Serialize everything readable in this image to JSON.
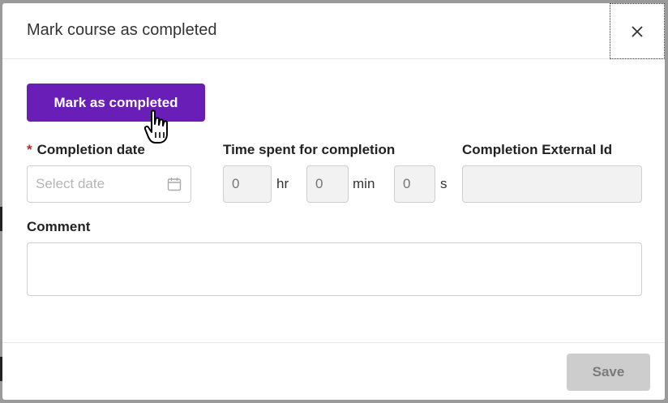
{
  "modal": {
    "title": "Mark course as completed",
    "close_icon": "close-icon"
  },
  "actions": {
    "mark_completed_label": "Mark as completed"
  },
  "fields": {
    "completion_date": {
      "required_mark": "*",
      "label": "Completion date",
      "placeholder": "Select date",
      "icon": "calendar-icon"
    },
    "time_spent": {
      "label": "Time spent for completion",
      "hours_placeholder": "0",
      "hours_unit": "hr",
      "minutes_placeholder": "0",
      "minutes_unit": "min",
      "seconds_placeholder": "0",
      "seconds_unit": "s"
    },
    "external_id": {
      "label": "Completion External Id",
      "value": ""
    },
    "comment": {
      "label": "Comment",
      "value": ""
    }
  },
  "footer": {
    "save_label": "Save"
  },
  "colors": {
    "primary": "#6a1eb8",
    "required": "#c0262d",
    "disabled_button": "#cdcdcd"
  }
}
